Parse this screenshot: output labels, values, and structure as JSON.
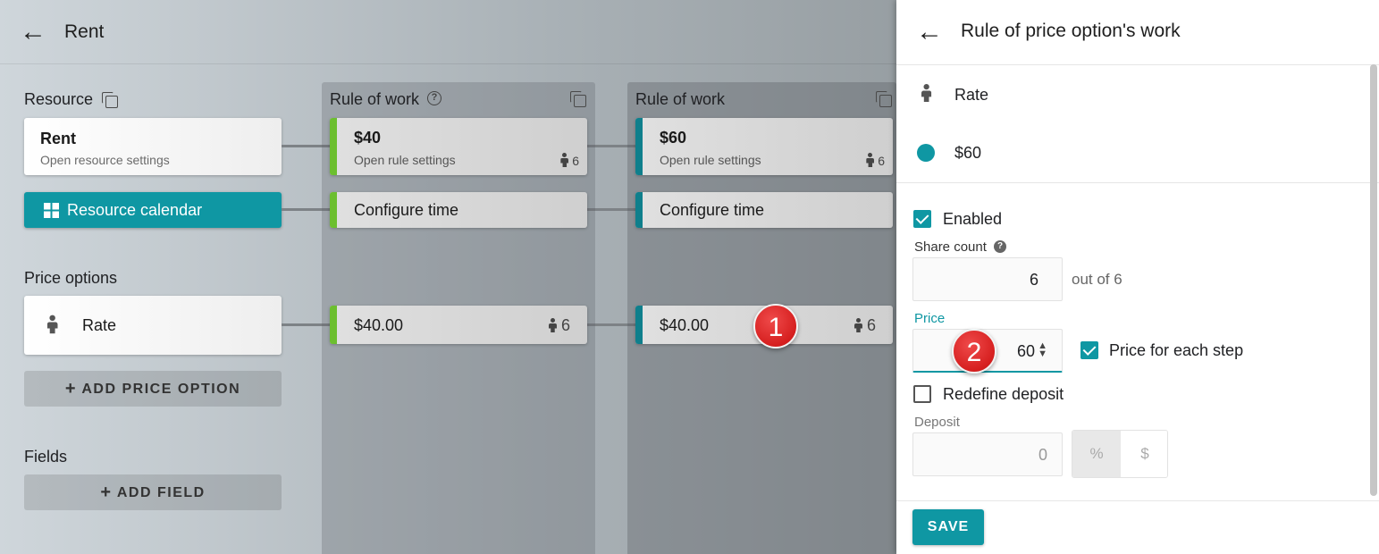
{
  "header": {
    "title": "Rent"
  },
  "left": {
    "resource_label": "Resource",
    "resource_card": {
      "title": "Rent",
      "subtitle": "Open resource settings"
    },
    "calendar_button": "Resource calendar",
    "price_options_label": "Price options",
    "price_option_card": {
      "label": "Rate"
    },
    "add_price_option": "ADD PRICE OPTION",
    "fields_label": "Fields",
    "add_field": "ADD FIELD"
  },
  "columns": [
    {
      "header": "Rule of work",
      "accent": "#6cbf2f",
      "rule_card": {
        "title": "$40",
        "subtitle": "Open rule settings",
        "count": "6"
      },
      "time_card": {
        "label": "Configure time"
      },
      "price_card": {
        "value": "$40.00",
        "count": "6"
      }
    },
    {
      "header": "Rule of work",
      "accent": "#0f7f8c",
      "rule_card": {
        "title": "$60",
        "subtitle": "Open rule settings",
        "count": "6"
      },
      "time_card": {
        "label": "Configure time"
      },
      "price_card": {
        "value": "$40.00",
        "count": "6"
      }
    }
  ],
  "markers": [
    "1",
    "2"
  ],
  "panel": {
    "title": "Rule of price option's work",
    "price_option_name": "Rate",
    "rule_name": "$60",
    "rule_color": "#0f97a3",
    "enabled_label": "Enabled",
    "enabled_checked": true,
    "share_count_label": "Share count",
    "share_count_value": "6",
    "share_count_total": "out of 6",
    "price_label": "Price",
    "price_value": "60",
    "price_each_step_label": "Price for each step",
    "price_each_step_checked": true,
    "redefine_deposit_label": "Redefine deposit",
    "redefine_deposit_checked": false,
    "deposit_label": "Deposit",
    "deposit_value": "0",
    "deposit_units": [
      "%",
      "$"
    ],
    "save_label": "SAVE"
  }
}
